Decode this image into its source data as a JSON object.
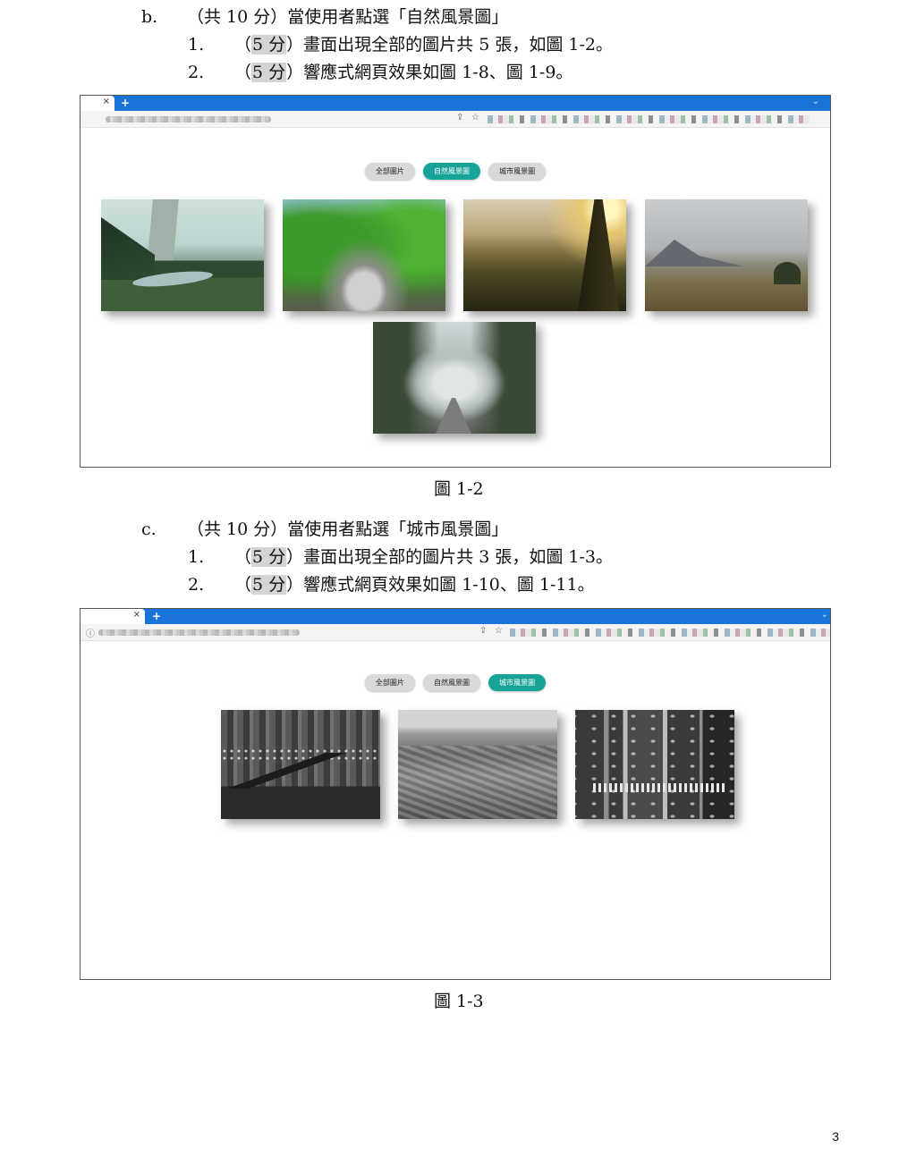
{
  "section_b": {
    "label": "b.",
    "text_before": "（共 10 分）當使用者點選「",
    "category": "自然風景圖",
    "text_after": "」",
    "items": [
      {
        "num": "1.",
        "points": "5 分",
        "pre": "（",
        "post": "）畫面出現全部的圖片共 5 張，如圖 1-2。"
      },
      {
        "num": "2.",
        "points": "5 分",
        "pre": "（",
        "post": "）響應式網頁效果如圖 1-8、圖 1-9。"
      }
    ]
  },
  "figure_1": {
    "caption": "圖 1-2",
    "browser": {
      "close": "×",
      "new_tab": "+",
      "menu": "⌄",
      "share_icon": "⇪",
      "star_icon": "☆"
    },
    "filters": [
      "全部圖片",
      "自然風景圖",
      "城市風景圖"
    ],
    "active_filter": "自然風景圖",
    "images": [
      "nature-foggy-lake",
      "nature-green-river",
      "nature-sunset-forest",
      "nature-mountain-meadow",
      "nature-misty-road"
    ]
  },
  "section_c": {
    "label": "c.",
    "text_before": "（共 10 分）當使用者點選「",
    "category": "城市風景圖",
    "text_after": "」",
    "items": [
      {
        "num": "1.",
        "points": "5 分",
        "pre": "（",
        "post": "）畫面出現全部的圖片共 3 張，如圖 1-3。"
      },
      {
        "num": "2.",
        "points": "5 分",
        "pre": "（",
        "post": "）響應式網頁效果如圖 1-10、圖 1-11。"
      }
    ]
  },
  "figure_2": {
    "caption": "圖 1-3",
    "browser": {
      "close": "×",
      "new_tab": "+",
      "menu": "⌄",
      "info_icon": "ⓘ",
      "share_icon": "⇪",
      "star_icon": "☆"
    },
    "filters": [
      "全部圖片",
      "自然風景圖",
      "城市風景圖"
    ],
    "active_filter": "城市風景圖",
    "images": [
      "city-bridge-night",
      "city-old-town",
      "city-traffic-road"
    ]
  },
  "colors": {
    "active": "#17a398",
    "tabbar": "#1a73d6",
    "inactive": "#d9d9d9",
    "highlight": "#d4d4d4"
  },
  "page_number": "3"
}
